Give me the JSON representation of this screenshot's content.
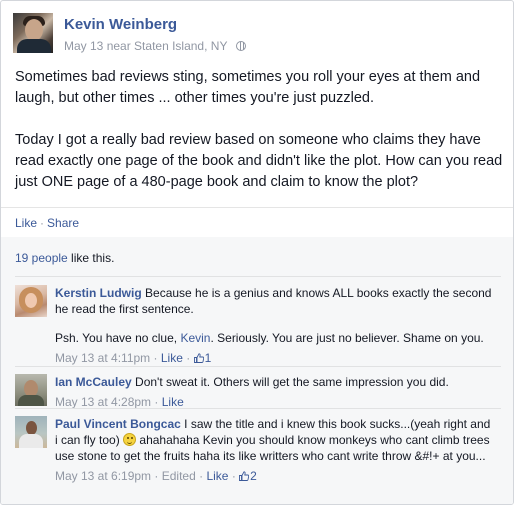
{
  "post": {
    "author": "Kevin Weinberg",
    "date": "May 13",
    "location": "near Staten Island, NY",
    "privacy_icon": "globe-icon",
    "paragraphs": [
      "Sometimes bad reviews sting, sometimes you roll your eyes at them and laugh, but other times ... other times you're just puzzled.",
      "Today I got a really bad review based on someone who claims they have read exactly one page of the book and didn't like the plot. How can you read just ONE page of a 480-page book and claim to know the plot?"
    ],
    "actions": {
      "like": "Like",
      "share": "Share"
    }
  },
  "likes": {
    "count_link": "19 people",
    "suffix": " like this."
  },
  "comments": [
    {
      "author": "Kerstin Ludwig",
      "text": "Because he is a genius and knows ALL books exactly the second he read the first sentence.",
      "text2_before": "Psh. You have no clue, ",
      "text2_mention": "Kevin",
      "text2_after": ". Seriously. You are just no believer. Shame on you.",
      "time": "May 13 at 4:11pm",
      "like_label": "Like",
      "like_count": "1"
    },
    {
      "author": "Ian McCauley",
      "text": "Don't sweat it. Others will get the same impression you did.",
      "time": "May 13 at 4:28pm",
      "like_label": "Like"
    },
    {
      "author": "Paul Vincent Bongcac",
      "text_before": "I saw the title and i knew this book sucks...(yeah right and i can fly too)",
      "text_after": "ahahahaha Kevin you should know monkeys who cant climb trees use stone to get the fruits haha its like writters who cant write throw &#!+ at you...",
      "time": "May 13 at 6:19pm",
      "edited": "Edited",
      "like_label": "Like",
      "like_count": "2"
    }
  ],
  "colors": {
    "link": "#3b5998",
    "meta": "#9197a3",
    "ufi_bg": "#f6f7f8"
  }
}
